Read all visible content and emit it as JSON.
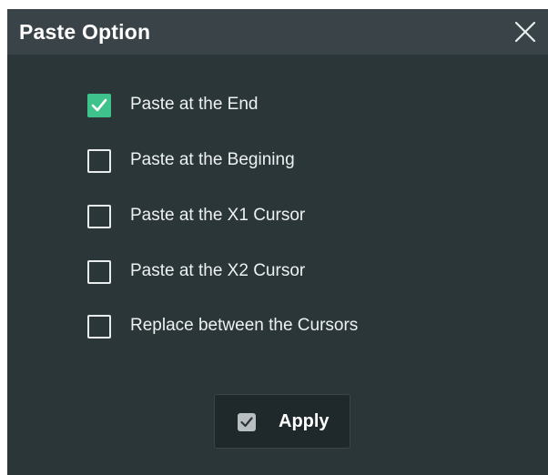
{
  "dialog": {
    "title": "Paste Option",
    "close_icon": "close-icon"
  },
  "options": [
    {
      "label": "Paste at the End",
      "checked": true
    },
    {
      "label": "Paste at the Begining",
      "checked": false
    },
    {
      "label": "Paste at the X1 Cursor",
      "checked": false
    },
    {
      "label": "Paste at the X2 Cursor",
      "checked": false
    },
    {
      "label": "Replace between the Cursors",
      "checked": false
    }
  ],
  "apply": {
    "label": "Apply",
    "icon": "check-icon"
  },
  "colors": {
    "background": "#2b3639",
    "titlebar": "#3a4448",
    "checked": "#3ec38d",
    "button": "#1f282a"
  }
}
